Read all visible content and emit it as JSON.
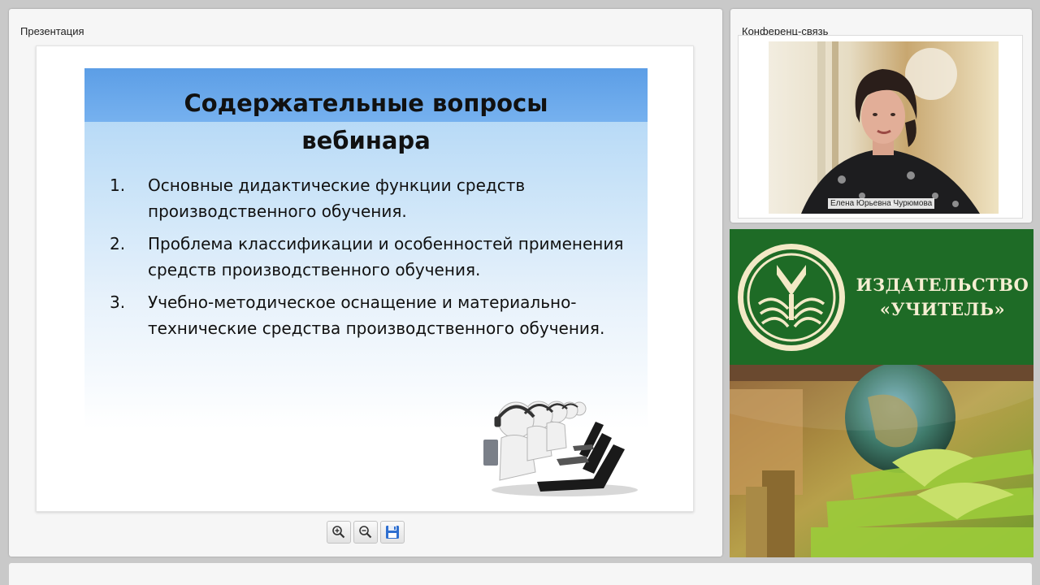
{
  "presentation_panel": {
    "title": "Презентация"
  },
  "slide": {
    "title_line1": "Содержательные вопросы",
    "title_line2": "вебинара",
    "items": [
      {
        "num": "1.",
        "text": "Основные дидактические функции средств производственного обучения."
      },
      {
        "num": "2.",
        "text": "Проблема классификации и  особенностей применения средств производственного обучения."
      },
      {
        "num": "3.",
        "text": "Учебно-методическое оснащение и материально-технические средства производственного обучения."
      }
    ]
  },
  "controls": {
    "zoom_in_icon": "zoom-in-icon",
    "zoom_out_icon": "zoom-out-icon",
    "save_icon": "floppy-disk-icon"
  },
  "conference_panel": {
    "title": "Конференц-связь",
    "speaker_name": "Елена Юрьевна Чурюмова"
  },
  "publisher": {
    "name_line1": "ИЗДАТЕЛЬСТВО",
    "name_line2": "«УЧИТЕЛЬ»"
  },
  "colors": {
    "publisher_green": "#1e6b26",
    "slide_band_blue": "#5c9ee6",
    "logo_cream": "#f5eed2"
  }
}
